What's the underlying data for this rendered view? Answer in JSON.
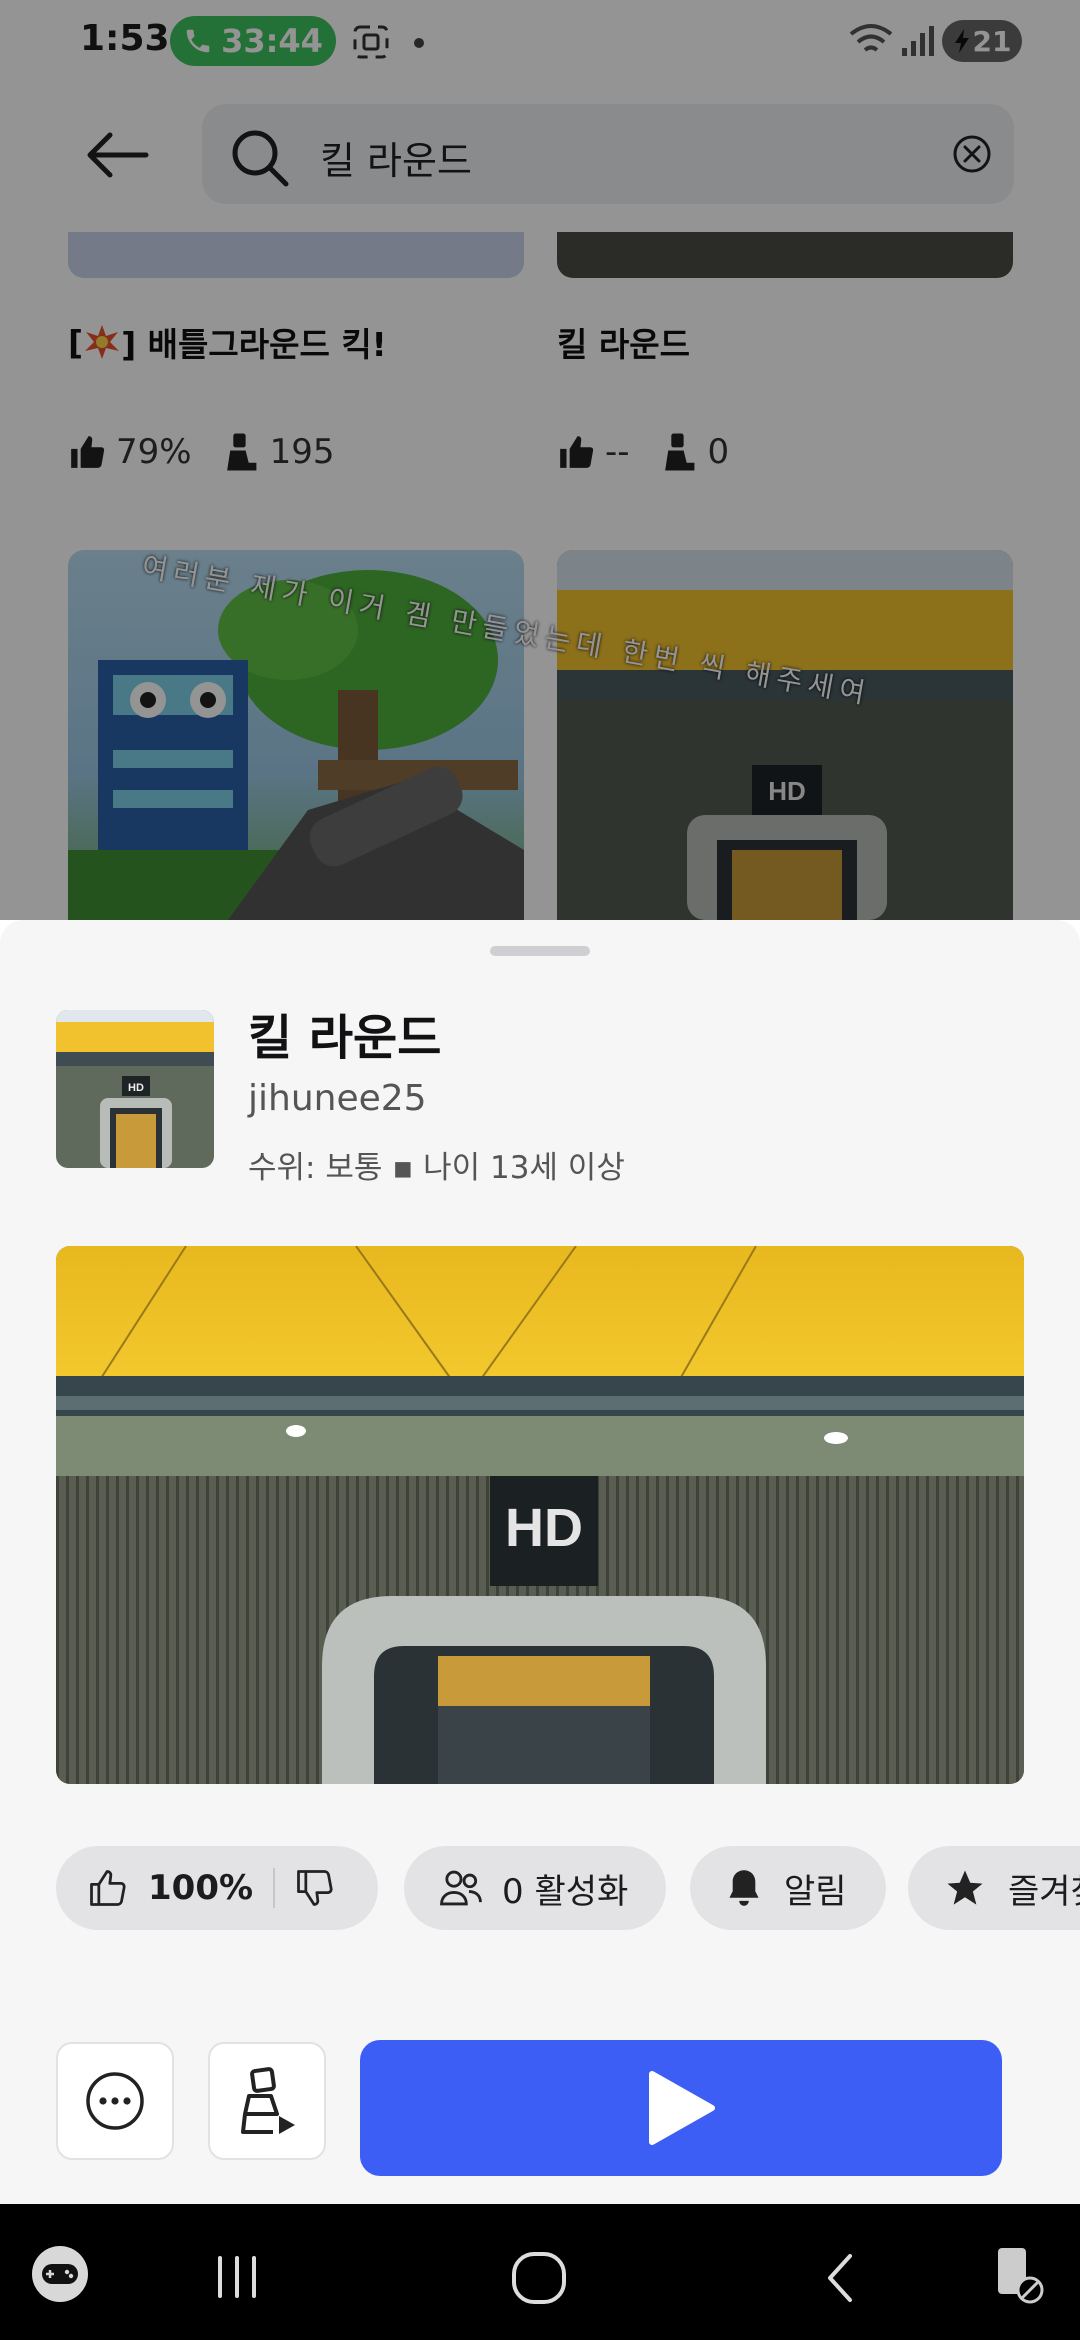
{
  "status_bar": {
    "time": "1:53",
    "call_timer": "33:44",
    "battery": "21"
  },
  "search": {
    "query": "킬 라운드"
  },
  "background_cards": [
    {
      "title_prefix": "[",
      "title_suffix": "] 배틀그라운드 킥!",
      "like_percent": "79%",
      "players": "195"
    },
    {
      "title": "킬 라운드",
      "like_percent": "--",
      "players": "0"
    }
  ],
  "overlay_caption": "여러분 제가 이거 겜 만들었는데 한번 씩 해주세여",
  "thumb_label": "HD",
  "game": {
    "title": "킬 라운드",
    "creator": "jihunee25",
    "meta": "수위: 보통 ▪ 나이 13세 이상"
  },
  "chips": {
    "rating": "100%",
    "active": "0 활성화",
    "notify": "알림",
    "favorite": "즐겨찾"
  },
  "colors": {
    "play_button": "#3d5ef5",
    "call_pill": "#3fc35f",
    "thumb_yellow": "#f2c12e"
  }
}
